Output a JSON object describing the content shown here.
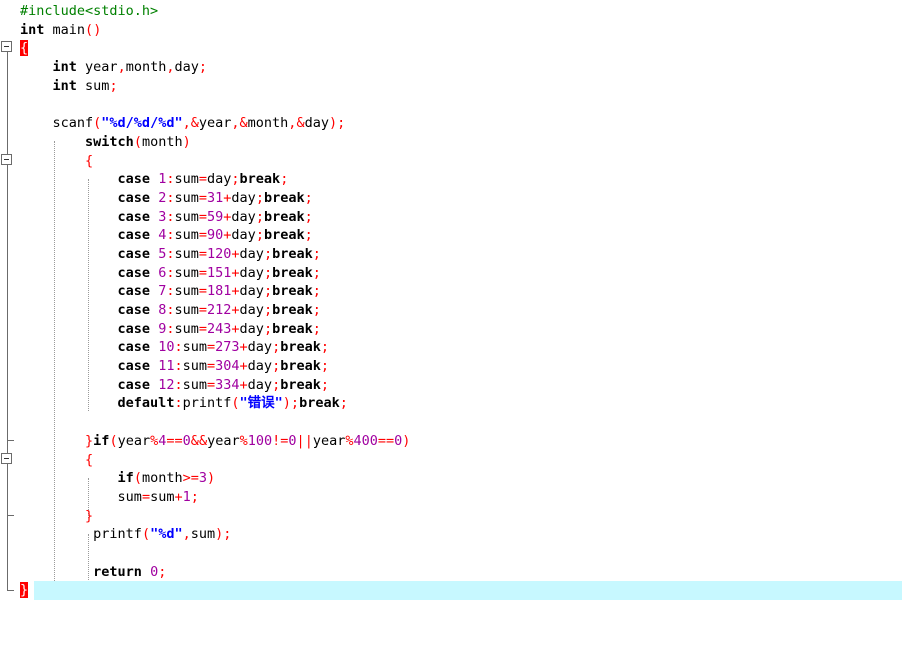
{
  "editor": {
    "language": "C",
    "current_line_color": "#c7f8ff",
    "colors": {
      "keyword": "#000000",
      "preprocessor": "#008000",
      "number": "#a000a0",
      "string": "#0000ff",
      "operator": "#ff0000",
      "bracket_match": "#ff0000"
    },
    "lines": [
      "#include<stdio.h>",
      "int main()",
      "{",
      "    int year,month,day;",
      "    int sum;",
      "",
      "    scanf(\"%d/%d/%d\",&year,&month,&day);",
      "        switch(month)",
      "        {",
      "            case 1:sum=day;break;",
      "            case 2:sum=31+day;break;",
      "            case 3:sum=59+day;break;",
      "            case 4:sum=90+day;break;",
      "            case 5:sum=120+day;break;",
      "            case 6:sum=151+day;break;",
      "            case 7:sum=181+day;break;",
      "            case 8:sum=212+day;break;",
      "            case 9:sum=243+day;break;",
      "            case 10:sum=273+day;break;",
      "            case 11:sum=304+day;break;",
      "            case 12:sum=334+day;break;",
      "            default:printf(\"错误\");break;",
      "",
      "        }if(year%4==0&&year%100!=0||year%400==0)",
      "        {",
      "            if(month>=3)",
      "            sum=sum+1;",
      "        }",
      "         printf(\"%d\",sum);",
      "",
      "         return 0;",
      "}"
    ]
  }
}
